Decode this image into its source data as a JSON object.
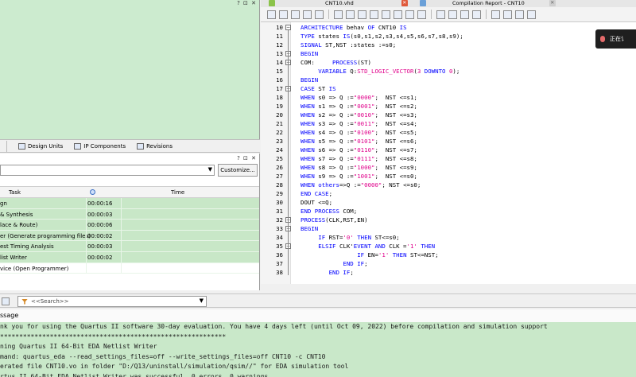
{
  "left_panel": {
    "top_controls": "? ⊡ ✕",
    "tabs": [
      {
        "label": "Design Units"
      },
      {
        "label": "IP Components"
      },
      {
        "label": "Revisions"
      }
    ],
    "task_controls": "? ⊡ ✕",
    "customize_label": "Customize...",
    "columns": {
      "task": "Task",
      "time": "Time"
    },
    "tasks": [
      {
        "name": "gn",
        "time": "00:00:16"
      },
      {
        "name": "& Synthesis",
        "time": "00:00:03"
      },
      {
        "name": "lace & Route)",
        "time": "00:00:06"
      },
      {
        "name": "er (Generate programming files)",
        "time": "00:00:02"
      },
      {
        "name": "est Timing Analysis",
        "time": "00:00:03"
      },
      {
        "name": "list Writer",
        "time": "00:00:02"
      },
      {
        "name": "vice (Open Programmer)",
        "time": ""
      }
    ]
  },
  "editor": {
    "tabs": [
      {
        "label": "CNT10.vhd"
      },
      {
        "label": "Compilation Report - CNT10"
      }
    ],
    "lines": [
      {
        "n": "10",
        "tokens": [
          {
            "t": "ARCHITECTURE",
            "k": "kw"
          },
          {
            "t": " behav "
          },
          {
            "t": "OF",
            "k": "kw"
          },
          {
            "t": " CNT10 "
          },
          {
            "t": "IS",
            "k": "kw"
          }
        ]
      },
      {
        "n": "11",
        "tokens": [
          {
            "t": "TYPE",
            "k": "kw"
          },
          {
            "t": " states "
          },
          {
            "t": "IS",
            "k": "kw"
          },
          {
            "t": "(s0,s1,s2,s3,s4,s5,s6,s7,s8,s9);"
          }
        ]
      },
      {
        "n": "12",
        "tokens": [
          {
            "t": "SIGNAL",
            "k": "kw"
          },
          {
            "t": " ST,NST :states :=s0;"
          }
        ]
      },
      {
        "n": "13",
        "tokens": [
          {
            "t": "BEGIN",
            "k": "kw"
          }
        ]
      },
      {
        "n": "14",
        "tokens": [
          {
            "t": "COM:     "
          },
          {
            "t": "PROCESS",
            "k": "kw"
          },
          {
            "t": "(ST)"
          }
        ]
      },
      {
        "n": "15",
        "tokens": [
          {
            "t": "     "
          },
          {
            "t": "VARIABLE",
            "k": "kw"
          },
          {
            "t": " Q:"
          },
          {
            "t": "STD_LOGIC_VECTOR",
            "k": "str"
          },
          {
            "t": "("
          },
          {
            "t": "3",
            "k": "num"
          },
          {
            "t": " "
          },
          {
            "t": "DOWNTO",
            "k": "kw"
          },
          {
            "t": " "
          },
          {
            "t": "0",
            "k": "num"
          },
          {
            "t": ");"
          }
        ]
      },
      {
        "n": "16",
        "tokens": [
          {
            "t": "BEGIN",
            "k": "kw"
          }
        ]
      },
      {
        "n": "17",
        "tokens": [
          {
            "t": "CASE",
            "k": "kw"
          },
          {
            "t": " ST "
          },
          {
            "t": "IS",
            "k": "kw"
          }
        ]
      },
      {
        "n": "18",
        "tokens": [
          {
            "t": "WHEN",
            "k": "kw"
          },
          {
            "t": " s0 => Q :="
          },
          {
            "t": "\"0000\"",
            "k": "str"
          },
          {
            "t": ";  NST <=s1;"
          }
        ]
      },
      {
        "n": "19",
        "tokens": [
          {
            "t": "WHEN",
            "k": "kw"
          },
          {
            "t": " s1 => Q :="
          },
          {
            "t": "\"0001\"",
            "k": "str"
          },
          {
            "t": ";  NST <=s2;"
          }
        ]
      },
      {
        "n": "20",
        "tokens": [
          {
            "t": "WHEN",
            "k": "kw"
          },
          {
            "t": " s2 => Q :="
          },
          {
            "t": "\"0010\"",
            "k": "str"
          },
          {
            "t": ";  NST <=s3;"
          }
        ]
      },
      {
        "n": "21",
        "tokens": [
          {
            "t": "WHEN",
            "k": "kw"
          },
          {
            "t": " s3 => Q :="
          },
          {
            "t": "\"0011\"",
            "k": "str"
          },
          {
            "t": ";  NST <=s4;"
          }
        ]
      },
      {
        "n": "22",
        "tokens": [
          {
            "t": "WHEN",
            "k": "kw"
          },
          {
            "t": " s4 => Q :="
          },
          {
            "t": "\"0100\"",
            "k": "str"
          },
          {
            "t": ";  NST <=s5;"
          }
        ]
      },
      {
        "n": "23",
        "tokens": [
          {
            "t": "WHEN",
            "k": "kw"
          },
          {
            "t": " s5 => Q :="
          },
          {
            "t": "\"0101\"",
            "k": "str"
          },
          {
            "t": ";  NST <=s6;"
          }
        ]
      },
      {
        "n": "24",
        "tokens": [
          {
            "t": "WHEN",
            "k": "kw"
          },
          {
            "t": " s6 => Q :="
          },
          {
            "t": "\"0110\"",
            "k": "str"
          },
          {
            "t": ";  NST <=s7;"
          }
        ]
      },
      {
        "n": "25",
        "tokens": [
          {
            "t": "WHEN",
            "k": "kw"
          },
          {
            "t": " s7 => Q :="
          },
          {
            "t": "\"0111\"",
            "k": "str"
          },
          {
            "t": ";  NST <=s8;"
          }
        ]
      },
      {
        "n": "26",
        "tokens": [
          {
            "t": "WHEN",
            "k": "kw"
          },
          {
            "t": " s8 => Q :="
          },
          {
            "t": "\"1000\"",
            "k": "str"
          },
          {
            "t": ";  NST <=s9;"
          }
        ]
      },
      {
        "n": "27",
        "tokens": [
          {
            "t": "WHEN",
            "k": "kw"
          },
          {
            "t": " s9 => Q :="
          },
          {
            "t": "\"1001\"",
            "k": "str"
          },
          {
            "t": ";  NST <=s0;"
          }
        ]
      },
      {
        "n": "28",
        "tokens": [
          {
            "t": "WHEN",
            "k": "kw"
          },
          {
            "t": " "
          },
          {
            "t": "others",
            "k": "kw"
          },
          {
            "t": "=>Q :="
          },
          {
            "t": "\"0000\"",
            "k": "str"
          },
          {
            "t": "; NST <=s0;"
          }
        ]
      },
      {
        "n": "29",
        "tokens": [
          {
            "t": "END CASE",
            "k": "kw"
          },
          {
            "t": ";"
          }
        ]
      },
      {
        "n": "30",
        "tokens": [
          {
            "t": "DOUT <=Q;"
          }
        ]
      },
      {
        "n": "31",
        "tokens": [
          {
            "t": "END PROCESS",
            "k": "kw"
          },
          {
            "t": " COM;"
          }
        ]
      },
      {
        "n": "32",
        "tokens": [
          {
            "t": "PROCESS",
            "k": "kw"
          },
          {
            "t": "(CLK,RST,EN)"
          }
        ]
      },
      {
        "n": "33",
        "tokens": [
          {
            "t": "BEGIN",
            "k": "kw"
          }
        ]
      },
      {
        "n": "34",
        "tokens": [
          {
            "t": "     "
          },
          {
            "t": "IF",
            "k": "kw"
          },
          {
            "t": " RST="
          },
          {
            "t": "'0'",
            "k": "str"
          },
          {
            "t": " "
          },
          {
            "t": "THEN",
            "k": "kw"
          },
          {
            "t": " ST<=s0;"
          }
        ]
      },
      {
        "n": "35",
        "tokens": [
          {
            "t": "     "
          },
          {
            "t": "ELSIF",
            "k": "kw"
          },
          {
            "t": " CLK'"
          },
          {
            "t": "EVENT",
            "k": "kw"
          },
          {
            "t": " "
          },
          {
            "t": "AND",
            "k": "kw"
          },
          {
            "t": " CLK ="
          },
          {
            "t": "'1'",
            "k": "str"
          },
          {
            "t": " "
          },
          {
            "t": "THEN",
            "k": "kw"
          }
        ]
      },
      {
        "n": "36",
        "tokens": [
          {
            "t": "                "
          },
          {
            "t": "IF",
            "k": "kw"
          },
          {
            "t": " EN="
          },
          {
            "t": "'1'",
            "k": "str"
          },
          {
            "t": " "
          },
          {
            "t": "THEN",
            "k": "kw"
          },
          {
            "t": " ST<=NST;"
          }
        ]
      },
      {
        "n": "37",
        "tokens": [
          {
            "t": "            "
          },
          {
            "t": "END IF",
            "k": "kw"
          },
          {
            "t": ";"
          }
        ]
      },
      {
        "n": "38",
        "tokens": [
          {
            "t": "        "
          },
          {
            "t": "END IF",
            "k": "kw"
          },
          {
            "t": ";"
          }
        ]
      }
    ]
  },
  "toast": {
    "text": "正在讠"
  },
  "messages": {
    "search_placeholder": "<<Search>>",
    "header": "ssage",
    "lines": [
      "nk you for using the Quartus II software 30-day evaluation. You have 4 days left (until Oct 09, 2022) before compilation and simulation support",
      "***********************************************************",
      "ning Quartus II 64-Bit EDA Netlist Writer",
      "mand: quartus_eda --read_settings_files=off --write_settings_files=off CNT10 -c CNT10",
      "erated file CNT10.vo in folder \"D:/Q13/uninstall/simulation/qsim//\" for EDA simulation tool",
      "rtus II 64-Bit EDA Netlist Writer was successful. 0 errors, 0 warnings"
    ]
  }
}
